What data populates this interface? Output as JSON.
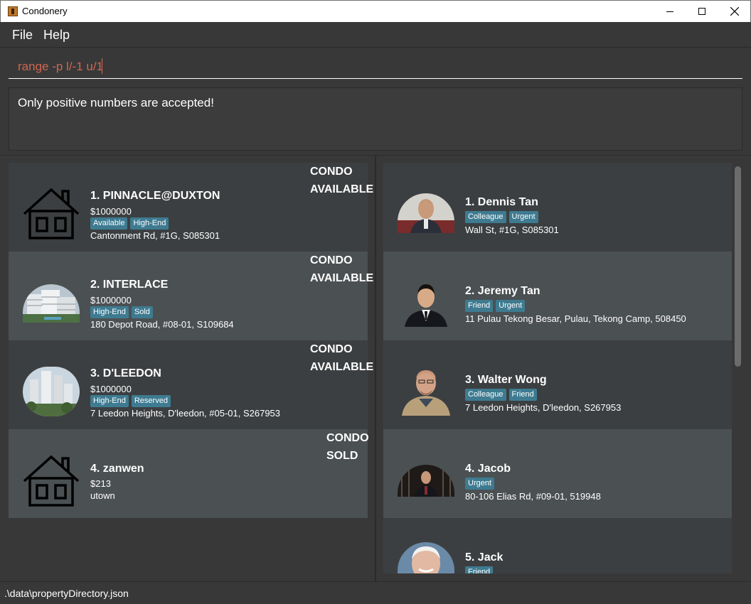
{
  "window": {
    "title": "Condonery"
  },
  "menu": {
    "file": "File",
    "help": "Help"
  },
  "command": {
    "value": "range -p l/-1 u/1"
  },
  "result": {
    "message": "Only positive numbers are accepted!"
  },
  "properties": [
    {
      "title": "1.  PINNACLE@DUXTON",
      "price": "$1000000",
      "tags": [
        "Available",
        "High-End"
      ],
      "address": "Cantonment Rd, #1G, S085301",
      "type": "CONDO",
      "status": "AVAILABLE",
      "image": "house-icon"
    },
    {
      "title": "2.  INTERLACE",
      "price": "$1000000",
      "tags": [
        "High-End",
        "Sold"
      ],
      "address": "180 Depot Road, #08-01, S109684",
      "type": "CONDO",
      "status": "AVAILABLE",
      "image": "property-photo"
    },
    {
      "title": "3.  D'LEEDON",
      "price": "$1000000",
      "tags": [
        "High-End",
        "Reserved"
      ],
      "address": "7 Leedon Heights, D'leedon, #05-01, S267953",
      "type": "CONDO",
      "status": "AVAILABLE",
      "image": "property-photo"
    },
    {
      "title": "4.  zanwen",
      "price": "$213",
      "tags": [],
      "address": "utown",
      "type": "CONDO",
      "status": "SOLD",
      "image": "house-icon"
    }
  ],
  "clients": [
    {
      "name": "1.  Dennis Tan",
      "tags": [
        "Colleague",
        "Urgent"
      ],
      "address": "Wall St, #1G, S085301"
    },
    {
      "name": "2.  Jeremy Tan",
      "tags": [
        "Friend",
        "Urgent"
      ],
      "address": "11 Pulau Tekong Besar, Pulau, Tekong Camp, 508450"
    },
    {
      "name": "3.  Walter Wong",
      "tags": [
        "Colleague",
        "Friend"
      ],
      "address": "7 Leedon Heights, D'leedon, S267953"
    },
    {
      "name": "4.  Jacob",
      "tags": [
        "Urgent"
      ],
      "address": "80-106 Elias Rd, #09-01, 519948"
    },
    {
      "name": "5.  Jack",
      "tags": [
        "Friend"
      ],
      "address": ""
    }
  ],
  "status": {
    "path": ".\\data\\propertyDirectory.json"
  }
}
